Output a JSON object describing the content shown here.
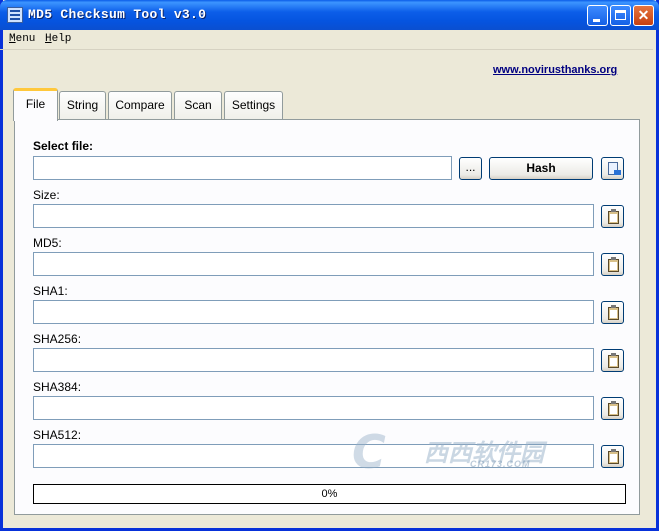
{
  "window": {
    "title": "MD5 Checksum Tool v3.0"
  },
  "menu": {
    "items": [
      "Menu",
      "Help"
    ]
  },
  "header": {
    "link": "www.novirusthanks.org"
  },
  "tabs": [
    {
      "label": "File",
      "active": true
    },
    {
      "label": "String",
      "active": false
    },
    {
      "label": "Compare",
      "active": false
    },
    {
      "label": "Scan",
      "active": false
    },
    {
      "label": "Settings",
      "active": false
    }
  ],
  "file_tab": {
    "select_label": "Select file:",
    "browse_label": "...",
    "hash_label": "Hash",
    "fields": [
      {
        "label": "Size:",
        "value": ""
      },
      {
        "label": "MD5:",
        "value": ""
      },
      {
        "label": "SHA1:",
        "value": ""
      },
      {
        "label": "SHA256:",
        "value": ""
      },
      {
        "label": "SHA384:",
        "value": ""
      },
      {
        "label": "SHA512:",
        "value": ""
      }
    ],
    "file_path": "",
    "progress_text": "0%",
    "progress": 0
  },
  "watermark": {
    "main": "西西软件园",
    "sub": "CR173.COM"
  },
  "colors": {
    "titlebar": "#0554e0",
    "link": "#000080",
    "tab_highlight": "#ffc83c",
    "window_bg": "#ece9d8"
  }
}
